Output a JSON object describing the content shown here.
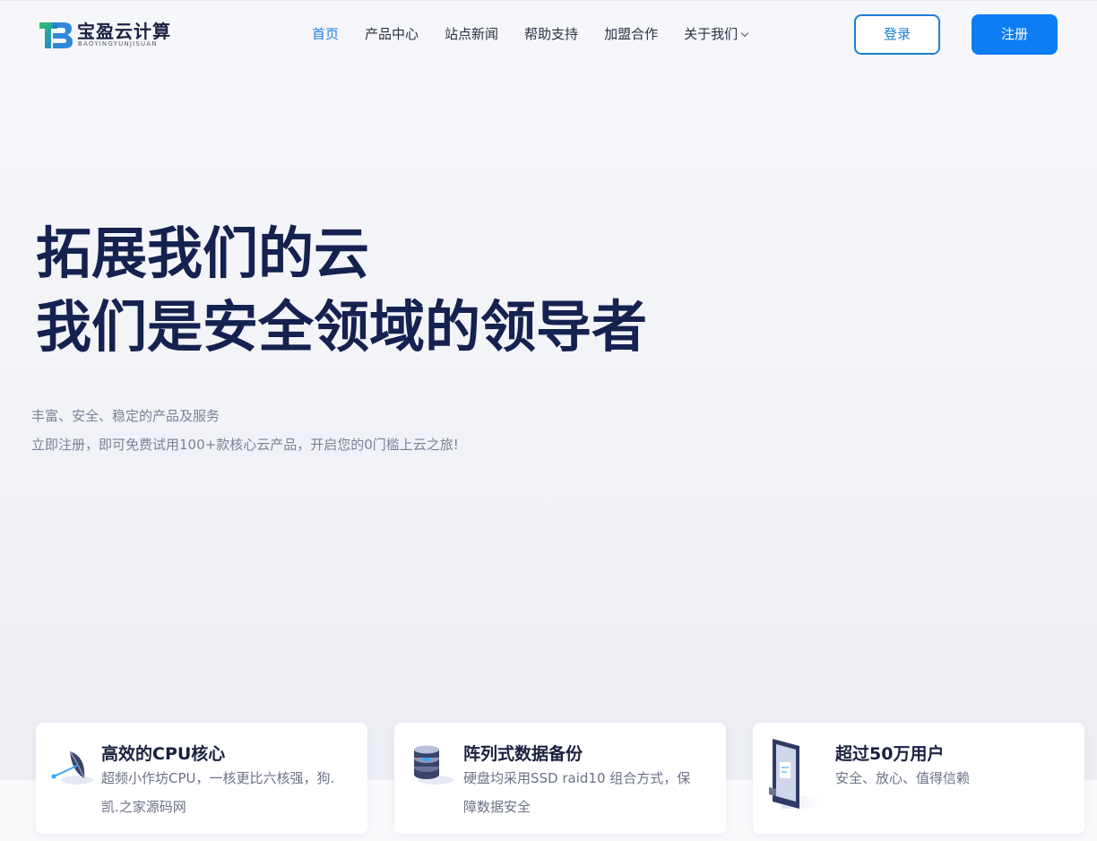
{
  "brand": {
    "name": "宝盈云计算",
    "sub": "BAOYINGYUNJISUAN"
  },
  "nav": {
    "items": [
      {
        "label": "首页",
        "active": true
      },
      {
        "label": "产品中心"
      },
      {
        "label": "站点新闻"
      },
      {
        "label": "帮助支持"
      },
      {
        "label": "加盟合作"
      },
      {
        "label": "关于我们",
        "dropdown": true
      }
    ]
  },
  "auth": {
    "login_label": "登录",
    "register_label": "注册"
  },
  "hero": {
    "title_line1": "拓展我们的云",
    "title_line2": "我们是安全领域的领导者",
    "sub_line1": "丰富、安全、稳定的产品及服务",
    "sub_line2": "立即注册，即可免费试用100+款核心云产品，开启您的0门槛上云之旅!"
  },
  "features": [
    {
      "title": "高效的CPU核心",
      "desc_line1": "超频小作坊CPU，一核更比六核强，狗.",
      "desc_line2": "凯.之家源码网",
      "icon": "satellite-dish-icon"
    },
    {
      "title": "阵列式数据备份",
      "desc_line1": "硬盘均采用SSD raid10 组合方式，保",
      "desc_line2": "障数据安全",
      "icon": "database-icon"
    },
    {
      "title": "超过50万用户",
      "desc_line1": "安全、放心、值得信赖",
      "desc_line2": "",
      "icon": "secure-door-icon"
    }
  ],
  "colors": {
    "accent": "#1e7dd8",
    "register_bg": "#0e7cf2",
    "hero_title": "#152250"
  }
}
